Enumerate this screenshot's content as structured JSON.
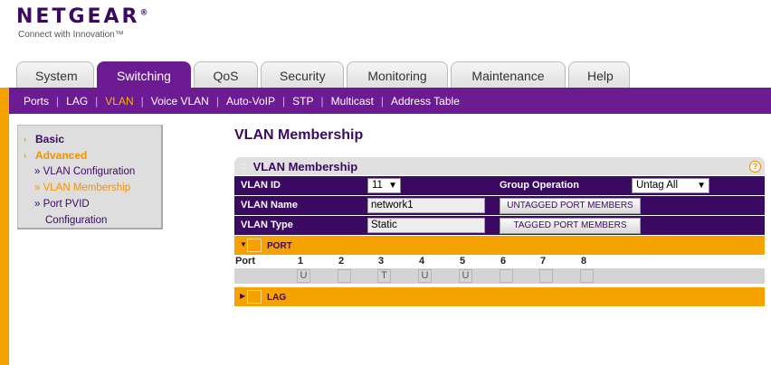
{
  "brand": {
    "name": "NETGEAR",
    "reg_mark": "®",
    "tagline": "Connect with Innovation™"
  },
  "tabs": [
    {
      "label": "System",
      "active": false
    },
    {
      "label": "Switching",
      "active": true
    },
    {
      "label": "QoS",
      "active": false
    },
    {
      "label": "Security",
      "active": false
    },
    {
      "label": "Monitoring",
      "active": false
    },
    {
      "label": "Maintenance",
      "active": false
    },
    {
      "label": "Help",
      "active": false
    }
  ],
  "subnav": [
    {
      "label": "Ports",
      "active": false
    },
    {
      "label": "LAG",
      "active": false
    },
    {
      "label": "VLAN",
      "active": true
    },
    {
      "label": "Voice VLAN",
      "active": false
    },
    {
      "label": "Auto-VoIP",
      "active": false
    },
    {
      "label": "STP",
      "active": false
    },
    {
      "label": "Multicast",
      "active": false
    },
    {
      "label": "Address Table",
      "active": false
    }
  ],
  "sidemenu": {
    "basic": "Basic",
    "advanced": "Advanced",
    "items": [
      "» VLAN Configuration",
      "» VLAN Membership",
      "» Port PVID",
      "Configuration"
    ]
  },
  "page_title": "VLAN Membership",
  "panel": {
    "title": "VLAN Membership",
    "help_icon": "?",
    "vlan_id_label": "VLAN ID",
    "vlan_id_value": "11",
    "group_op_label": "Group Operation",
    "group_op_value": "Untag All",
    "vlan_name_label": "VLAN Name",
    "vlan_name_value": "network1",
    "untagged_btn": "UNTAGGED PORT MEMBERS",
    "vlan_type_label": "VLAN Type",
    "vlan_type_value": "Static",
    "tagged_btn": "TAGGED PORT MEMBERS",
    "port_section": "PORT",
    "port_label": "Port",
    "ports": [
      {
        "num": "1",
        "state": "U"
      },
      {
        "num": "2",
        "state": ""
      },
      {
        "num": "3",
        "state": "T"
      },
      {
        "num": "4",
        "state": "U"
      },
      {
        "num": "5",
        "state": "U"
      },
      {
        "num": "6",
        "state": ""
      },
      {
        "num": "7",
        "state": ""
      },
      {
        "num": "8",
        "state": ""
      }
    ],
    "lag_section": "LAG"
  },
  "colors": {
    "purple": "#6d1b93",
    "dark_purple": "#3a0a63",
    "orange": "#f5a100",
    "active_orange": "#ffb400"
  },
  "icons": {
    "help": "help-icon",
    "expand": "triangle-down-icon",
    "collapse": "triangle-right-icon",
    "grip": "drag-handle-icon"
  }
}
